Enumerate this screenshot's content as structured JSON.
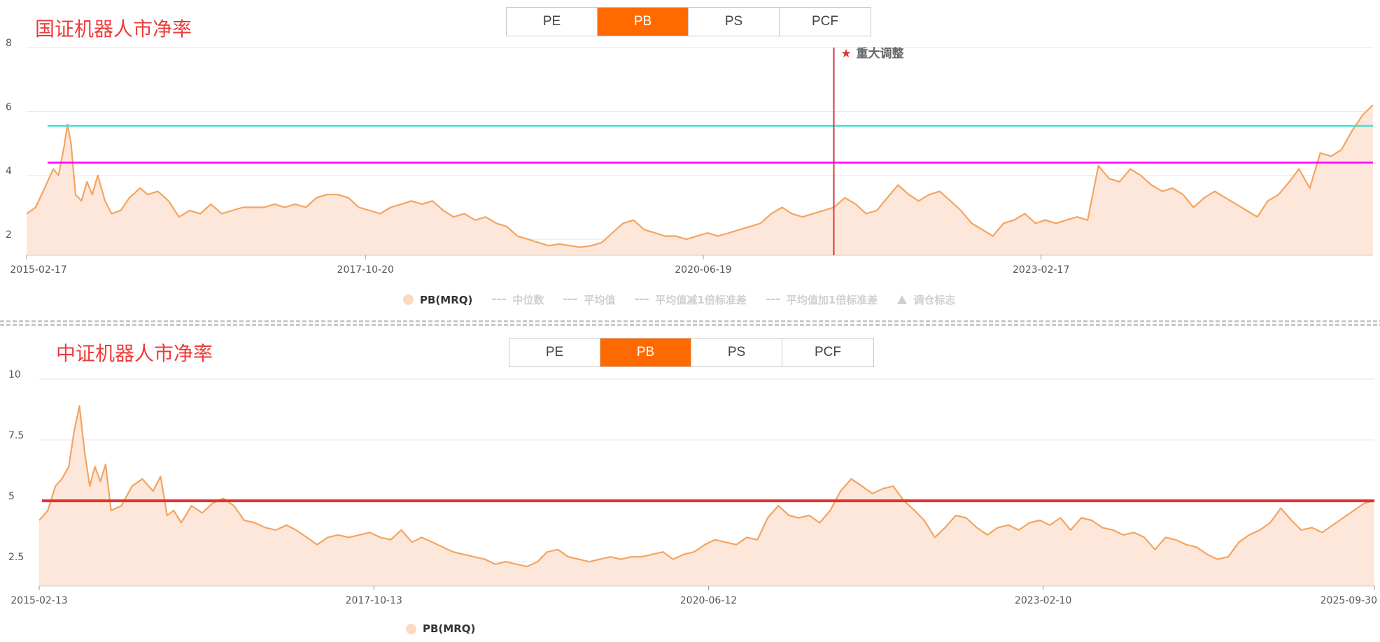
{
  "colors": {
    "title": "#ee3b3b",
    "tab_active_bg": "#ff6a00",
    "pb_line": "#f4a460",
    "pb_fill": "#fde7da",
    "cyan_line": "#40e0d0",
    "magenta_line": "#ff00ff",
    "red_line": "#e23232",
    "adjust_marker": "#e23232",
    "grid": "#e6e6e6"
  },
  "tabs": [
    {
      "label": "PE",
      "active": false
    },
    {
      "label": "PB",
      "active": true
    },
    {
      "label": "PS",
      "active": false
    },
    {
      "label": "PCF",
      "active": false
    }
  ],
  "top": {
    "title": "国证机器人市净率",
    "legend": {
      "pb": "PB(MRQ)",
      "median": "中位数",
      "mean": "平均值",
      "mean_minus_std": "平均值减1倍标准差",
      "mean_plus_std": "平均值加1倍标准差",
      "adjust_mark": "调仓标志"
    },
    "annotation": "重大调整"
  },
  "bottom": {
    "title": "中证机器人市净率",
    "legend": {
      "pb": "PB(MRQ)"
    }
  },
  "chart_data": [
    {
      "type": "area",
      "title": "国证机器人市净率",
      "series_name": "PB(MRQ)",
      "yticks": [
        "2",
        "4",
        "6",
        "8"
      ],
      "ylim": [
        1.5,
        8
      ],
      "xticks": [
        "2015-02-17",
        "2017-10-20",
        "2020-06-19",
        "2023-02-17"
      ],
      "xlim": [
        "2015-02-17",
        "2025-09-30"
      ],
      "grid": true,
      "hlines": [
        {
          "value": 5.55,
          "color": "#40e0d0"
        },
        {
          "value": 4.4,
          "color": "#ff00ff"
        }
      ],
      "vline": {
        "date": "2021-06-30",
        "label": "重大调整"
      },
      "points": [
        [
          "2015-02-17",
          2.8
        ],
        [
          "2015-03-15",
          3.0
        ],
        [
          "2015-04-10",
          3.6
        ],
        [
          "2015-05-05",
          4.2
        ],
        [
          "2015-05-20",
          4.0
        ],
        [
          "2015-06-05",
          4.9
        ],
        [
          "2015-06-15",
          5.6
        ],
        [
          "2015-06-25",
          5.0
        ],
        [
          "2015-07-08",
          3.4
        ],
        [
          "2015-07-25",
          3.2
        ],
        [
          "2015-08-10",
          3.8
        ],
        [
          "2015-08-25",
          3.4
        ],
        [
          "2015-09-10",
          4.0
        ],
        [
          "2015-10-01",
          3.2
        ],
        [
          "2015-10-20",
          2.8
        ],
        [
          "2015-11-15",
          2.9
        ],
        [
          "2015-12-10",
          3.3
        ],
        [
          "2016-01-10",
          3.6
        ],
        [
          "2016-02-01",
          3.4
        ],
        [
          "2016-03-01",
          3.5
        ],
        [
          "2016-04-01",
          3.2
        ],
        [
          "2016-05-01",
          2.7
        ],
        [
          "2016-06-01",
          2.9
        ],
        [
          "2016-07-01",
          2.8
        ],
        [
          "2016-08-01",
          3.1
        ],
        [
          "2016-09-01",
          2.8
        ],
        [
          "2016-10-01",
          2.9
        ],
        [
          "2016-11-01",
          3.0
        ],
        [
          "2016-12-01",
          3.0
        ],
        [
          "2017-01-01",
          3.0
        ],
        [
          "2017-02-01",
          3.1
        ],
        [
          "2017-03-01",
          3.0
        ],
        [
          "2017-04-01",
          3.1
        ],
        [
          "2017-05-01",
          3.0
        ],
        [
          "2017-06-01",
          3.3
        ],
        [
          "2017-07-01",
          3.4
        ],
        [
          "2017-08-01",
          3.4
        ],
        [
          "2017-09-01",
          3.3
        ],
        [
          "2017-10-01",
          3.0
        ],
        [
          "2017-11-01",
          2.9
        ],
        [
          "2017-12-01",
          2.8
        ],
        [
          "2018-01-01",
          3.0
        ],
        [
          "2018-02-01",
          3.1
        ],
        [
          "2018-03-01",
          3.2
        ],
        [
          "2018-04-01",
          3.1
        ],
        [
          "2018-05-01",
          3.2
        ],
        [
          "2018-06-01",
          2.9
        ],
        [
          "2018-07-01",
          2.7
        ],
        [
          "2018-08-01",
          2.8
        ],
        [
          "2018-09-01",
          2.6
        ],
        [
          "2018-10-01",
          2.7
        ],
        [
          "2018-11-01",
          2.5
        ],
        [
          "2018-12-01",
          2.4
        ],
        [
          "2019-01-01",
          2.1
        ],
        [
          "2019-02-01",
          2.0
        ],
        [
          "2019-03-01",
          1.9
        ],
        [
          "2019-04-01",
          1.8
        ],
        [
          "2019-05-01",
          1.85
        ],
        [
          "2019-06-01",
          1.8
        ],
        [
          "2019-07-01",
          1.75
        ],
        [
          "2019-08-01",
          1.8
        ],
        [
          "2019-09-01",
          1.9
        ],
        [
          "2019-10-01",
          2.2
        ],
        [
          "2019-11-01",
          2.5
        ],
        [
          "2019-12-01",
          2.6
        ],
        [
          "2020-01-01",
          2.3
        ],
        [
          "2020-02-01",
          2.2
        ],
        [
          "2020-03-01",
          2.1
        ],
        [
          "2020-04-01",
          2.1
        ],
        [
          "2020-05-01",
          2.0
        ],
        [
          "2020-06-01",
          2.1
        ],
        [
          "2020-07-01",
          2.2
        ],
        [
          "2020-08-01",
          2.1
        ],
        [
          "2020-09-01",
          2.2
        ],
        [
          "2020-10-01",
          2.3
        ],
        [
          "2020-11-01",
          2.4
        ],
        [
          "2020-12-01",
          2.5
        ],
        [
          "2021-01-01",
          2.8
        ],
        [
          "2021-02-01",
          3.0
        ],
        [
          "2021-03-01",
          2.8
        ],
        [
          "2021-04-01",
          2.7
        ],
        [
          "2021-05-01",
          2.8
        ],
        [
          "2021-06-01",
          2.9
        ],
        [
          "2021-06-30",
          3.0
        ],
        [
          "2021-08-01",
          3.3
        ],
        [
          "2021-09-01",
          3.1
        ],
        [
          "2021-10-01",
          2.8
        ],
        [
          "2021-11-01",
          2.9
        ],
        [
          "2021-12-01",
          3.3
        ],
        [
          "2022-01-01",
          3.7
        ],
        [
          "2022-02-01",
          3.4
        ],
        [
          "2022-03-01",
          3.2
        ],
        [
          "2022-04-01",
          3.4
        ],
        [
          "2022-05-01",
          3.5
        ],
        [
          "2022-06-01",
          3.2
        ],
        [
          "2022-07-01",
          2.9
        ],
        [
          "2022-08-01",
          2.5
        ],
        [
          "2022-09-01",
          2.3
        ],
        [
          "2022-10-01",
          2.1
        ],
        [
          "2022-11-01",
          2.5
        ],
        [
          "2022-12-01",
          2.6
        ],
        [
          "2023-01-01",
          2.8
        ],
        [
          "2023-02-01",
          2.5
        ],
        [
          "2023-03-01",
          2.6
        ],
        [
          "2023-04-01",
          2.5
        ],
        [
          "2023-05-01",
          2.6
        ],
        [
          "2023-06-01",
          2.7
        ],
        [
          "2023-07-01",
          2.6
        ],
        [
          "2023-08-01",
          4.3
        ],
        [
          "2023-09-01",
          3.9
        ],
        [
          "2023-10-01",
          3.8
        ],
        [
          "2023-11-01",
          4.2
        ],
        [
          "2023-12-01",
          4.0
        ],
        [
          "2024-01-01",
          3.7
        ],
        [
          "2024-02-01",
          3.5
        ],
        [
          "2024-03-01",
          3.6
        ],
        [
          "2024-04-01",
          3.4
        ],
        [
          "2024-05-01",
          3.0
        ],
        [
          "2024-06-01",
          3.3
        ],
        [
          "2024-07-01",
          3.5
        ],
        [
          "2024-08-01",
          3.3
        ],
        [
          "2024-09-01",
          3.1
        ],
        [
          "2024-10-01",
          2.9
        ],
        [
          "2024-11-01",
          2.7
        ],
        [
          "2024-12-01",
          3.2
        ],
        [
          "2025-01-01",
          3.4
        ],
        [
          "2025-02-01",
          3.8
        ],
        [
          "2025-03-01",
          4.2
        ],
        [
          "2025-04-01",
          3.6
        ],
        [
          "2025-05-01",
          4.7
        ],
        [
          "2025-06-01",
          4.6
        ],
        [
          "2025-07-01",
          4.8
        ],
        [
          "2025-08-01",
          5.4
        ],
        [
          "2025-09-01",
          5.9
        ],
        [
          "2025-09-30",
          6.2
        ]
      ]
    },
    {
      "type": "area",
      "title": "中证机器人市净率",
      "series_name": "PB(MRQ)",
      "yticks": [
        "2.5",
        "5",
        "7.5",
        "10"
      ],
      "ylim": [
        1.5,
        10
      ],
      "xticks": [
        "2015-02-13",
        "2017-10-13",
        "2020-06-12",
        "2023-02-10",
        "2025-09-30"
      ],
      "xlim": [
        "2015-02-13",
        "2025-09-30"
      ],
      "grid": true,
      "hlines": [
        {
          "value": 5.0,
          "color": "#e23232"
        }
      ],
      "points": [
        [
          "2015-02-13",
          4.2
        ],
        [
          "2015-03-10",
          4.6
        ],
        [
          "2015-04-01",
          5.6
        ],
        [
          "2015-04-20",
          5.9
        ],
        [
          "2015-05-10",
          6.4
        ],
        [
          "2015-05-25",
          7.8
        ],
        [
          "2015-06-10",
          8.9
        ],
        [
          "2015-06-25",
          7.0
        ],
        [
          "2015-07-10",
          5.6
        ],
        [
          "2015-07-25",
          6.4
        ],
        [
          "2015-08-10",
          5.8
        ],
        [
          "2015-08-25",
          6.5
        ],
        [
          "2015-09-10",
          4.6
        ],
        [
          "2015-10-10",
          4.8
        ],
        [
          "2015-11-10",
          5.6
        ],
        [
          "2015-12-10",
          5.9
        ],
        [
          "2016-01-10",
          5.4
        ],
        [
          "2016-02-01",
          6.0
        ],
        [
          "2016-02-20",
          4.4
        ],
        [
          "2016-03-10",
          4.6
        ],
        [
          "2016-04-01",
          4.1
        ],
        [
          "2016-05-01",
          4.8
        ],
        [
          "2016-06-01",
          4.5
        ],
        [
          "2016-07-01",
          4.9
        ],
        [
          "2016-08-01",
          5.1
        ],
        [
          "2016-09-01",
          4.8
        ],
        [
          "2016-10-01",
          4.2
        ],
        [
          "2016-11-01",
          4.1
        ],
        [
          "2016-12-01",
          3.9
        ],
        [
          "2017-01-01",
          3.8
        ],
        [
          "2017-02-01",
          4.0
        ],
        [
          "2017-03-01",
          3.8
        ],
        [
          "2017-04-01",
          3.5
        ],
        [
          "2017-05-01",
          3.2
        ],
        [
          "2017-06-01",
          3.5
        ],
        [
          "2017-07-01",
          3.6
        ],
        [
          "2017-08-01",
          3.5
        ],
        [
          "2017-09-01",
          3.6
        ],
        [
          "2017-10-01",
          3.7
        ],
        [
          "2017-11-01",
          3.5
        ],
        [
          "2017-12-01",
          3.4
        ],
        [
          "2018-01-01",
          3.8
        ],
        [
          "2018-02-01",
          3.3
        ],
        [
          "2018-03-01",
          3.5
        ],
        [
          "2018-04-01",
          3.3
        ],
        [
          "2018-05-01",
          3.1
        ],
        [
          "2018-06-01",
          2.9
        ],
        [
          "2018-07-01",
          2.8
        ],
        [
          "2018-08-01",
          2.7
        ],
        [
          "2018-09-01",
          2.6
        ],
        [
          "2018-10-01",
          2.4
        ],
        [
          "2018-11-01",
          2.5
        ],
        [
          "2018-12-01",
          2.4
        ],
        [
          "2019-01-01",
          2.3
        ],
        [
          "2019-02-01",
          2.5
        ],
        [
          "2019-03-01",
          2.9
        ],
        [
          "2019-04-01",
          3.0
        ],
        [
          "2019-05-01",
          2.7
        ],
        [
          "2019-06-01",
          2.6
        ],
        [
          "2019-07-01",
          2.5
        ],
        [
          "2019-08-01",
          2.6
        ],
        [
          "2019-09-01",
          2.7
        ],
        [
          "2019-10-01",
          2.6
        ],
        [
          "2019-11-01",
          2.7
        ],
        [
          "2019-12-01",
          2.7
        ],
        [
          "2020-01-01",
          2.8
        ],
        [
          "2020-02-01",
          2.9
        ],
        [
          "2020-03-01",
          2.6
        ],
        [
          "2020-04-01",
          2.8
        ],
        [
          "2020-05-01",
          2.9
        ],
        [
          "2020-06-01",
          3.2
        ],
        [
          "2020-07-01",
          3.4
        ],
        [
          "2020-08-01",
          3.3
        ],
        [
          "2020-09-01",
          3.2
        ],
        [
          "2020-10-01",
          3.5
        ],
        [
          "2020-11-01",
          3.4
        ],
        [
          "2020-12-01",
          4.3
        ],
        [
          "2021-01-01",
          4.8
        ],
        [
          "2021-02-01",
          4.4
        ],
        [
          "2021-03-01",
          4.3
        ],
        [
          "2021-04-01",
          4.4
        ],
        [
          "2021-05-01",
          4.1
        ],
        [
          "2021-06-01",
          4.6
        ],
        [
          "2021-07-01",
          5.4
        ],
        [
          "2021-08-01",
          5.9
        ],
        [
          "2021-09-01",
          5.6
        ],
        [
          "2021-10-01",
          5.3
        ],
        [
          "2021-11-01",
          5.5
        ],
        [
          "2021-12-01",
          5.6
        ],
        [
          "2022-01-01",
          5.0
        ],
        [
          "2022-02-01",
          4.6
        ],
        [
          "2022-03-01",
          4.2
        ],
        [
          "2022-04-01",
          3.5
        ],
        [
          "2022-05-01",
          3.9
        ],
        [
          "2022-06-01",
          4.4
        ],
        [
          "2022-07-01",
          4.3
        ],
        [
          "2022-08-01",
          3.9
        ],
        [
          "2022-09-01",
          3.6
        ],
        [
          "2022-10-01",
          3.9
        ],
        [
          "2022-11-01",
          4.0
        ],
        [
          "2022-12-01",
          3.8
        ],
        [
          "2023-01-01",
          4.1
        ],
        [
          "2023-02-01",
          4.2
        ],
        [
          "2023-03-01",
          4.0
        ],
        [
          "2023-04-01",
          4.3
        ],
        [
          "2023-05-01",
          3.8
        ],
        [
          "2023-06-01",
          4.3
        ],
        [
          "2023-07-01",
          4.2
        ],
        [
          "2023-08-01",
          3.9
        ],
        [
          "2023-09-01",
          3.8
        ],
        [
          "2023-10-01",
          3.6
        ],
        [
          "2023-11-01",
          3.7
        ],
        [
          "2023-12-01",
          3.5
        ],
        [
          "2024-01-01",
          3.0
        ],
        [
          "2024-02-01",
          3.5
        ],
        [
          "2024-03-01",
          3.4
        ],
        [
          "2024-04-01",
          3.2
        ],
        [
          "2024-05-01",
          3.1
        ],
        [
          "2024-06-01",
          2.8
        ],
        [
          "2024-07-01",
          2.6
        ],
        [
          "2024-08-01",
          2.7
        ],
        [
          "2024-09-01",
          3.3
        ],
        [
          "2024-10-01",
          3.6
        ],
        [
          "2024-11-01",
          3.8
        ],
        [
          "2024-12-01",
          4.1
        ],
        [
          "2025-01-01",
          4.7
        ],
        [
          "2025-02-01",
          4.2
        ],
        [
          "2025-03-01",
          3.8
        ],
        [
          "2025-04-01",
          3.9
        ],
        [
          "2025-05-01",
          3.7
        ],
        [
          "2025-06-01",
          4.0
        ],
        [
          "2025-07-01",
          4.3
        ],
        [
          "2025-08-01",
          4.6
        ],
        [
          "2025-09-01",
          4.9
        ],
        [
          "2025-09-30",
          5.0
        ]
      ]
    }
  ]
}
